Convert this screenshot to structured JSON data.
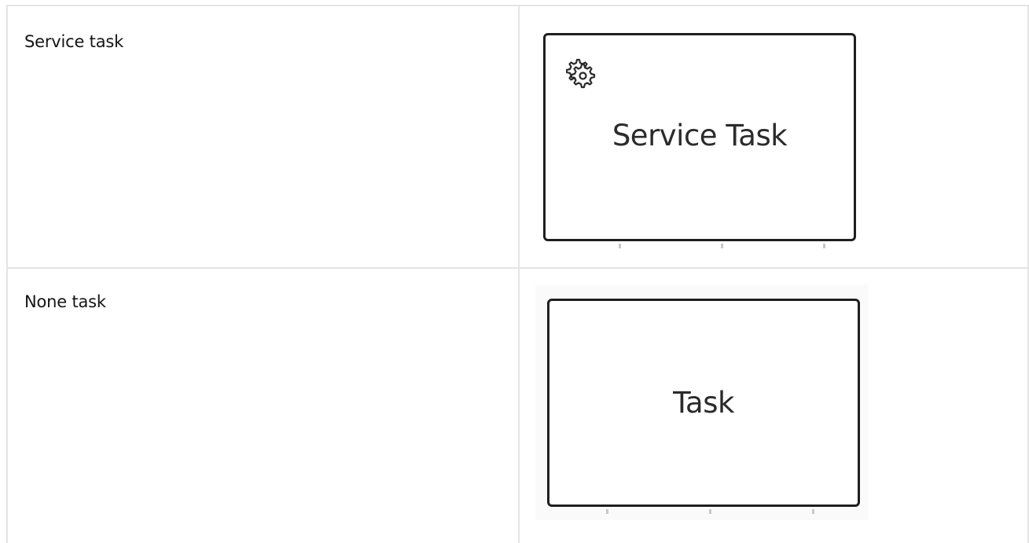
{
  "rows": [
    {
      "label": "Service task",
      "shape": {
        "type": "service-task",
        "title": "Service Task",
        "icon": "gear-icon"
      }
    },
    {
      "label": "None task",
      "shape": {
        "type": "none-task",
        "title": "Task"
      }
    }
  ],
  "colors": {
    "border": "#e4e4e4",
    "shape_stroke": "#1f1f1f",
    "text": "#151515"
  }
}
